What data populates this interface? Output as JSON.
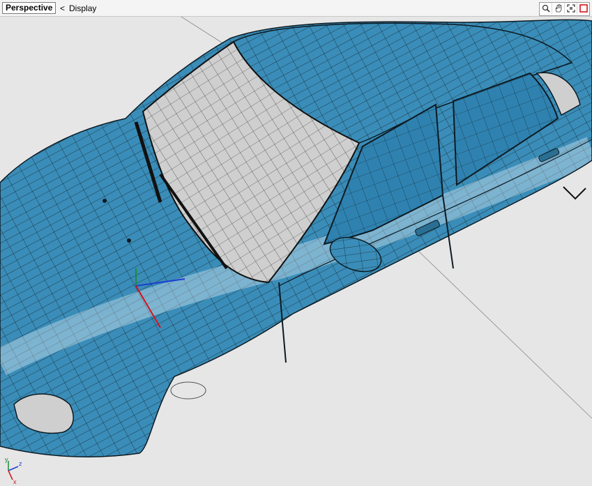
{
  "toolbar": {
    "view_name": "Perspective",
    "menu_chevron": "<",
    "menu_label": "Display",
    "icons": [
      "zoom-icon",
      "pan-hand-icon",
      "fit-view-icon",
      "maximize-view-icon"
    ]
  },
  "axes": {
    "x": "x",
    "y": "y",
    "z": "z"
  },
  "colors": {
    "car_body": "#3a8db8",
    "glass": "#c9c9c9",
    "wire": "#0d1a22",
    "background": "#e6e6e6"
  }
}
